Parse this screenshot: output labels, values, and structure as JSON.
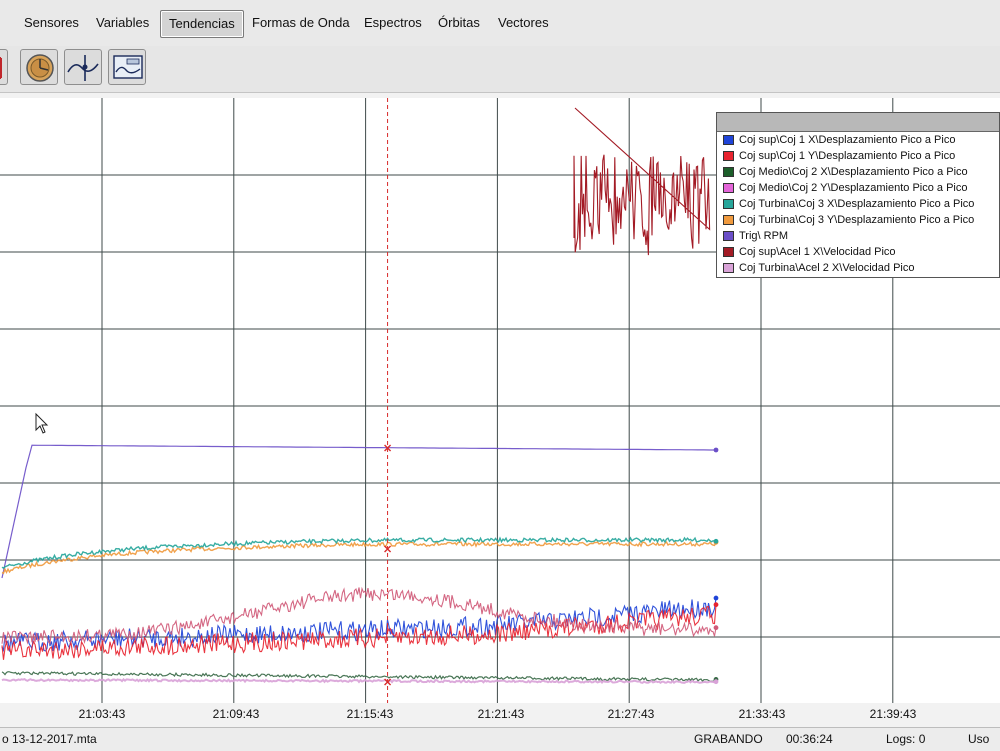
{
  "tabs": [
    {
      "label": "Sensores"
    },
    {
      "label": "Variables"
    },
    {
      "label": "Tendencias",
      "active": true
    },
    {
      "label": "Formas de Onda"
    },
    {
      "label": "Espectros"
    },
    {
      "label": "Órbitas"
    },
    {
      "label": "Vectores"
    }
  ],
  "toolbar": {
    "icons": [
      "axis-marker-icon",
      "clock-gauge-icon",
      "trend-cursor-icon",
      "waveform-window-icon"
    ]
  },
  "legend": {
    "items": [
      {
        "label": "Coj sup\\Coj 1 X\\Desplazamiento Pico a Pico",
        "color": "#1f44d8"
      },
      {
        "label": "Coj sup\\Coj 1 Y\\Desplazamiento Pico a Pico",
        "color": "#e8232f"
      },
      {
        "label": "Coj Medio\\Coj 2 X\\Desplazamiento Pico a Pico",
        "color": "#1c5e2a"
      },
      {
        "label": "Coj Medio\\Coj 2 Y\\Desplazamiento Pico a Pico",
        "color": "#e364d8"
      },
      {
        "label": "Coj Turbina\\Coj 3 X\\Desplazamiento Pico a Pico",
        "color": "#27a69b"
      },
      {
        "label": "Coj Turbina\\Coj 3 Y\\Desplazamiento Pico a Pico",
        "color": "#f09a3e"
      },
      {
        "label": "Trig\\ RPM",
        "color": "#6b4fc8"
      },
      {
        "label": "Coj sup\\Acel 1 X\\Velocidad Pico",
        "color": "#a31b25"
      },
      {
        "label": "Coj Turbina\\Acel 2 X\\Velocidad Pico",
        "color": "#d9a3d8"
      }
    ]
  },
  "chart_data": {
    "type": "line",
    "x_ticks": [
      "21:03:43",
      "21:09:43",
      "21:15:43",
      "21:21:43",
      "21:27:43",
      "21:33:43",
      "21:39:43"
    ],
    "cursor_time": "21:16:43",
    "data_end_time": "21:31:43",
    "series": [
      {
        "name": "Trig\\ RPM",
        "color": "#6b4fc8",
        "shape": "ramp-then-flat"
      },
      {
        "name": "Coj Turbina\\Coj 3 Y\\Desplazamiento Pico a Pico",
        "color": "#f09a3e",
        "shape": "rise-then-flat"
      },
      {
        "name": "Coj Turbina\\Coj 3 X\\Desplazamiento Pico a Pico",
        "color": "#27a69b",
        "shape": "rise-then-flat"
      },
      {
        "name": "Coj sup\\Coj 1 X\\Desplazamiento Pico a Pico",
        "color": "#1f44d8",
        "shape": "noisy-slow-rise"
      },
      {
        "name": "Coj sup\\Coj 1 Y\\Desplazamiento Pico a Pico",
        "color": "#e8232f",
        "shape": "noisy-slow-rise"
      },
      {
        "name": "Coj sup\\Acel 1 X\\Velocidad Pico",
        "color": "#d05a78",
        "shape": "hump"
      },
      {
        "name": "Coj Medio\\Coj 2 X\\Desplazamiento Pico a Pico",
        "color": "#3a6a48",
        "shape": "flat-low"
      },
      {
        "name": "Coj Turbina\\Acel 2 X\\Velocidad Pico",
        "color": "#d9a3d8",
        "shape": "flat-lowest"
      },
      {
        "name": "Coj sup\\Acel 1 X\\Velocidad Pico",
        "color": "#a31b25",
        "shape": "high-noise-burst"
      }
    ]
  },
  "status": {
    "file": "o 13-12-2017.mta",
    "state": "GRABANDO",
    "elapsed": "00:36:24",
    "logs": "Logs: 0",
    "uso": "Uso"
  }
}
